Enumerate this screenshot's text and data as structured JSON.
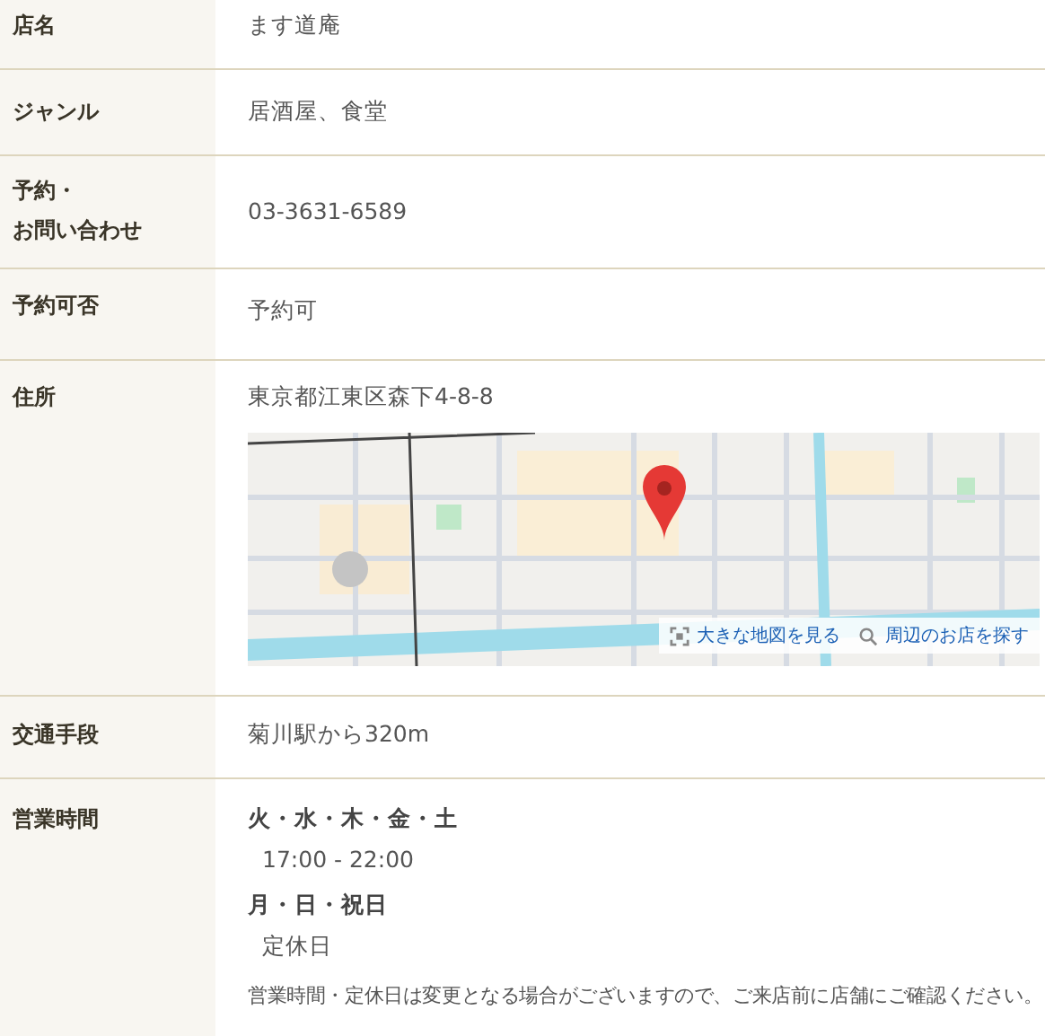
{
  "rows": [
    {
      "kind": "text",
      "label": "店名",
      "value": "ます道庵"
    },
    {
      "kind": "text",
      "label": "ジャンル",
      "value": "居酒屋、食堂"
    },
    {
      "kind": "text",
      "label_lines": [
        "予約・",
        "お問い合わせ"
      ],
      "value": "03-3631-6589"
    },
    {
      "kind": "text",
      "label": "予約可否",
      "value": "予約可"
    },
    {
      "kind": "map",
      "label": "住所",
      "value": "東京都江東区森下4-8-8",
      "map": {
        "kind": "picture",
        "links": [
          "大きな地図を見る",
          "周辺のお店を探す"
        ]
      }
    },
    {
      "kind": "text",
      "label": "交通手段",
      "value": "菊川駅から320m"
    },
    {
      "kind": "hours",
      "label": "営業時間",
      "groups": [
        {
          "days": "火・水・木・金・土",
          "time": "17:00 - 22:00"
        },
        {
          "days": "月・日・祝日",
          "time": "定休日"
        }
      ],
      "note": "営業時間・定休日は変更となる場合がございますので、ご来店前に店舗にご確認ください。"
    }
  ]
}
